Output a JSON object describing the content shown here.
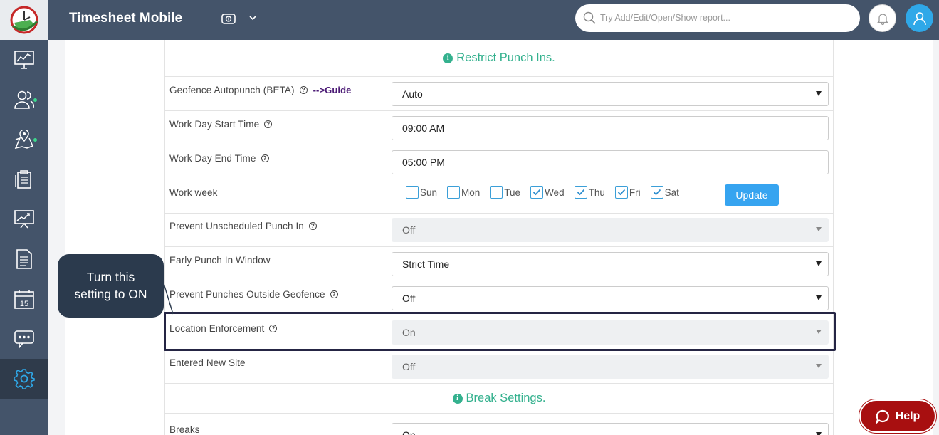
{
  "app": {
    "title": "Timesheet Mobile",
    "search_placeholder": "Try Add/Edit/Open/Show report..."
  },
  "colors": {
    "header_bg": "#44546a",
    "accent": "#34b18e",
    "primary_button": "#36a4f0",
    "help_button": "#a80f10",
    "callout_bg": "#2b3a4d"
  },
  "sidebar": {
    "items": [
      {
        "icon": "dashboard-monitor-icon",
        "active": false
      },
      {
        "icon": "users-icon",
        "active": false,
        "has_dot": true
      },
      {
        "icon": "map-location-icon",
        "active": false,
        "has_dot": true
      },
      {
        "icon": "timesheet-clipboard-icon",
        "active": false
      },
      {
        "icon": "reports-chart-icon",
        "active": false
      },
      {
        "icon": "document-icon",
        "active": false
      },
      {
        "icon": "calendar-icon",
        "active": false,
        "text": "15"
      },
      {
        "icon": "messages-icon",
        "active": false
      },
      {
        "icon": "settings-gear-icon",
        "active": true
      }
    ]
  },
  "sections": {
    "restrict": "Restrict Punch Ins.",
    "breaks": "Break Settings."
  },
  "rows": {
    "geofence": {
      "label": "Geofence Autopunch (BETA)",
      "guide": "-->Guide",
      "value": "Auto"
    },
    "start": {
      "label": "Work Day Start Time",
      "value": "09:00 AM"
    },
    "end": {
      "label": "Work Day End Time",
      "value": "05:00 PM"
    },
    "week": {
      "label": "Work week",
      "days": [
        {
          "name": "Sun",
          "checked": false
        },
        {
          "name": "Mon",
          "checked": false
        },
        {
          "name": "Tue",
          "checked": false
        },
        {
          "name": "Wed",
          "checked": true
        },
        {
          "name": "Thu",
          "checked": true
        },
        {
          "name": "Fri",
          "checked": true
        },
        {
          "name": "Sat",
          "checked": true
        }
      ],
      "update_label": "Update"
    },
    "unscheduled": {
      "label": "Prevent Unscheduled Punch In",
      "value": "Off"
    },
    "early": {
      "label": "Early Punch In Window",
      "value": "Strict Time"
    },
    "outside": {
      "label": "Prevent Punches Outside Geofence",
      "value": "Off"
    },
    "location": {
      "label": "Location Enforcement",
      "value": "On"
    },
    "new_site": {
      "label": "Entered New Site",
      "value": "Off"
    },
    "breaks": {
      "label": "Breaks",
      "value": "On"
    }
  },
  "callout": {
    "line1": "Turn this",
    "line2": "setting to ON"
  },
  "help": {
    "label": "Help"
  }
}
